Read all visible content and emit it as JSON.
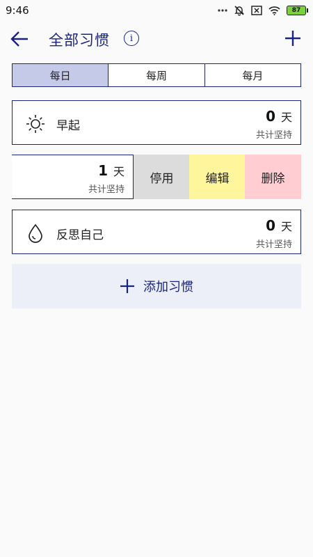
{
  "status_bar": {
    "time": "9:46",
    "battery": "87"
  },
  "header": {
    "title": "全部习惯",
    "info_glyph": "i",
    "back_icon": "arrow-left-icon",
    "add_icon": "plus-icon"
  },
  "tabs": [
    {
      "label": "每日",
      "active": true
    },
    {
      "label": "每周",
      "active": false
    },
    {
      "label": "每月",
      "active": false
    }
  ],
  "habits": [
    {
      "name": "早起",
      "icon": "sun-icon",
      "days": "0",
      "unit": "天",
      "label": "共计坚持"
    },
    {
      "name": "",
      "icon": "",
      "days": "1",
      "unit": "天",
      "label": "共计坚持"
    },
    {
      "name": "反思自己",
      "icon": "water-drop-icon",
      "days": "0",
      "unit": "天",
      "label": "共计坚持"
    }
  ],
  "swipe_actions": {
    "disable": "停用",
    "edit": "编辑",
    "delete": "删除"
  },
  "add_habit": {
    "label": "添加习惯"
  },
  "colors": {
    "accent": "#1a237e",
    "active_tab": "#c5cae9",
    "disable_bg": "#dcdcdc",
    "edit_bg": "#fff59d",
    "delete_bg": "#ffcdd2",
    "add_bg": "#eceef8"
  }
}
